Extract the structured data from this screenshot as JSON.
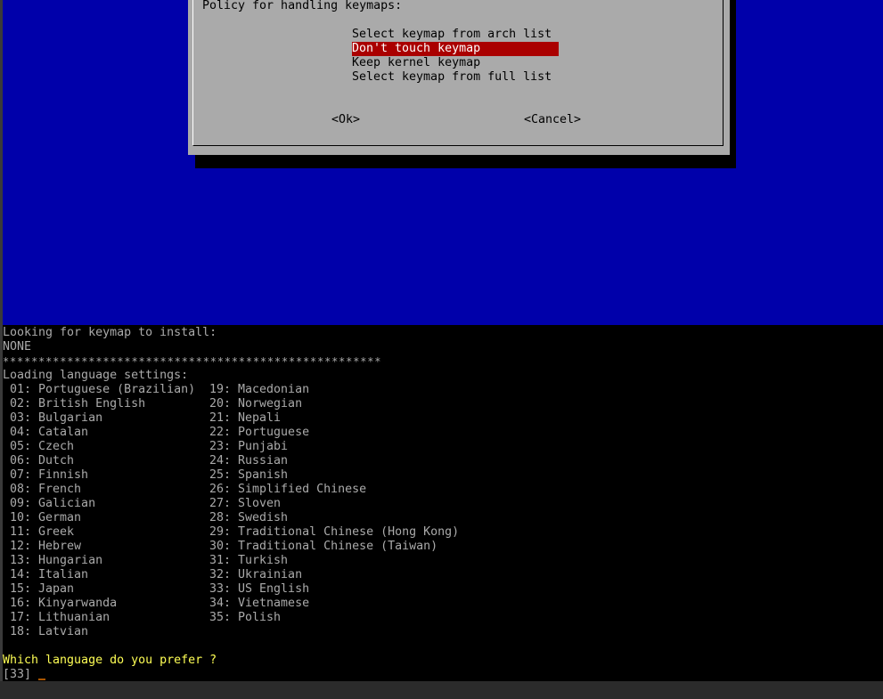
{
  "dialog": {
    "prompt": "Policy for handling keymaps:",
    "items": [
      "Select keymap from arch list",
      "Don't touch keymap",
      "Keep kernel keymap",
      "Select keymap from full list"
    ],
    "selected_index": 1,
    "ok_label": "<Ok>",
    "cancel_label": "<Cancel>"
  },
  "terminal": {
    "looking_line": "Looking for keymap to install:",
    "none_line": "NONE",
    "stars_line": "*****************************************************",
    "loading_line": "Loading language settings:",
    "languages_left": [
      " 01: Portuguese (Brazilian)",
      " 02: British English",
      " 03: Bulgarian",
      " 04: Catalan",
      " 05: Czech",
      " 06: Dutch",
      " 07: Finnish",
      " 08: French",
      " 09: Galician",
      " 10: German",
      " 11: Greek",
      " 12: Hebrew",
      " 13: Hungarian",
      " 14: Italian",
      " 15: Japan",
      " 16: Kinyarwanda",
      " 17: Lithuanian",
      " 18: Latvian"
    ],
    "languages_right": [
      "19: Macedonian",
      "20: Norwegian",
      "21: Nepali",
      "22: Portuguese",
      "23: Punjabi",
      "24: Russian",
      "25: Spanish",
      "26: Simplified Chinese",
      "27: Sloven",
      "28: Swedish",
      "29: Traditional Chinese (Hong Kong)",
      "30: Traditional Chinese (Taiwan)",
      "31: Turkish",
      "32: Ukrainian",
      "33: US English",
      "34: Vietnamese",
      "35: Polish"
    ],
    "question": "Which language do you prefer ?",
    "input_default": "[33] "
  },
  "colors": {
    "background_blue": "#0000aa",
    "dialog_gray": "#aaaaaa",
    "selection_red": "#aa0000",
    "question_yellow": "#ffff55",
    "terminal_text": "#aaaaaa"
  }
}
